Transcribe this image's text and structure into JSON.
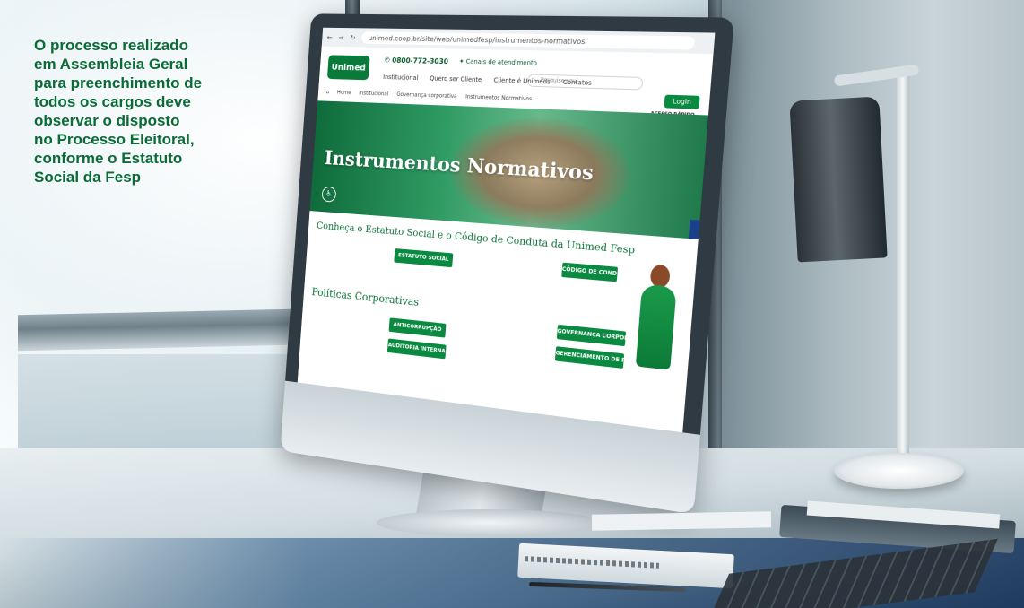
{
  "headline": {
    "lines": [
      "O processo realizado",
      "em Assembleia Geral",
      "para preenchimento de",
      "todos os cargos deve",
      "observar o disposto",
      "no Processo Eleitoral,",
      "conforme o Estatuto",
      "Social da Fesp"
    ]
  },
  "browser": {
    "url": "unimed.coop.br/site/web/unimedfesp/instrumentos-normativos"
  },
  "site": {
    "logo": "Unimed",
    "phone": "0800-772-3030",
    "canais": "Canais de atendimento",
    "nav": [
      "Institucional",
      "Quero ser Cliente",
      "Cliente é Unimeds",
      "Contatos"
    ],
    "search_placeholder": "Pesquise aqui",
    "login": "Login",
    "breadcrumb": [
      "Home",
      "Institucional",
      "Governança corporativa",
      "Instrumentos Normativos"
    ],
    "acesso_rapido": "ACESSO RÁPIDO",
    "hero_title": "Instrumentos Normativos",
    "section1_title": "Conheça o Estatuto Social e o Código de Conduta da Unimed Fesp",
    "btn_estatuto": "ESTATUTO SOCIAL",
    "btn_codigo": "CÓDIGO DE CONDUTA",
    "section2_title": "Políticas Corporativas",
    "btn_anticorrupcao": "ANTICORRUPÇÃO",
    "btn_auditoria": "AUDITORIA INTERNA",
    "btn_governanca": "GOVERNANÇA CORPORATIVA",
    "btn_gerenciamento": "GERENCIAMENTO DE RISCOS"
  },
  "colors": {
    "brand_green": "#0a8a41",
    "headline_green": "#0b6b36"
  }
}
